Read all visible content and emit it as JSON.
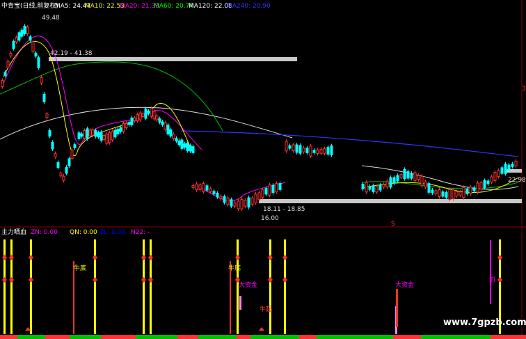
{
  "main_header": {
    "title": "中青宝(日线,前复权)",
    "ma": [
      {
        "label": "MA5: 24.47",
        "color": "#ffffff"
      },
      {
        "label": "MA10: 22.53",
        "color": "#ffff00"
      },
      {
        "label": "MA20: 21.33",
        "color": "#ff00ff"
      },
      {
        "label": "MA60: 20.74",
        "color": "#00ff00"
      },
      {
        "label": "MA120: 22.08",
        "color": "#ffffff"
      },
      {
        "label": "MA240: 20.90",
        "color": "#3333ff"
      }
    ]
  },
  "sub_header": {
    "title": "主力晒血",
    "items": [
      {
        "label": "ZN: 0.00",
        "color": "#ff00ff"
      },
      {
        "label": "QN: 0.00",
        "color": "#ffff00"
      },
      {
        "label": "ZL: 0.00",
        "color": "#0000ff"
      },
      {
        "label": "N22: -",
        "color": "#ff00ff"
      }
    ]
  },
  "annotations": {
    "high": "49.48",
    "band_upper": "42.19 - 41.38",
    "band_lower": "18.11 - 18.85",
    "low": "16.00",
    "right_price": "22.98",
    "right_axis": "3",
    "marker": "S"
  },
  "signals": {
    "niudi": "牛底",
    "dazijin": "大资金",
    "zhua": "抓",
    "niuqi": "牛起"
  },
  "watermark": "www.7gpzb.com",
  "chart_data": {
    "type": "candlestick + indicator bars",
    "price_extremes": {
      "high": 49.48,
      "low": 16.0
    },
    "support_bands": [
      [
        41.38,
        42.19
      ],
      [
        18.11,
        18.85
      ]
    ],
    "last_price_label": 22.98,
    "moving_averages": {
      "MA5": 24.47,
      "MA10": 22.53,
      "MA20": 21.33,
      "MA60": 20.74,
      "MA120": 22.08,
      "MA240": 20.9
    },
    "indicator": {
      "ZN": 0.0,
      "QN": 0.0,
      "ZL": 0.0,
      "N22": "-"
    }
  },
  "colors": {
    "up": "#ff3333",
    "down": "#00ffff",
    "grid": "#8b0000",
    "band": "#c8c8c8",
    "yellow": "#ffff00",
    "magenta": "#ff00ff",
    "green": "#00c000"
  }
}
